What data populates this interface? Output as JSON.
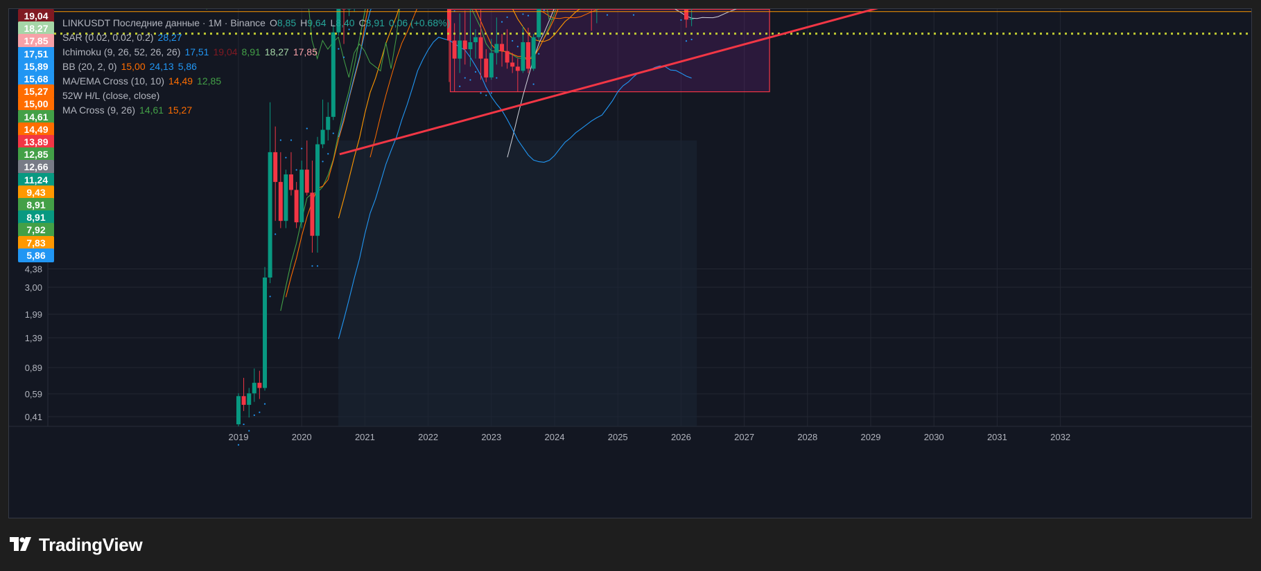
{
  "header": {
    "symbol_line": [
      {
        "text": "LINKUSDT Последние данные · 1M · Binance",
        "color": "#b2b5be"
      },
      {
        "text": "O",
        "color": "#b2b5be"
      },
      {
        "text": "8,85",
        "color": "#26a69a"
      },
      {
        "text": "H",
        "color": "#b2b5be"
      },
      {
        "text": "9,64",
        "color": "#26a69a"
      },
      {
        "text": "L",
        "color": "#b2b5be"
      },
      {
        "text": "8,40",
        "color": "#26a69a"
      },
      {
        "text": "C",
        "color": "#b2b5be"
      },
      {
        "text": "8,91",
        "color": "#26a69a"
      },
      {
        "text": "0,06 (+0.68%)",
        "color": "#26a69a"
      }
    ],
    "indicators": [
      {
        "name": "SAR (0.02, 0.02, 0.2)",
        "values": [
          {
            "text": "28,27",
            "color": "#2196f3"
          }
        ]
      },
      {
        "name": "Ichimoku (9, 26, 52, 26, 26)",
        "values": [
          {
            "text": "17,51",
            "color": "#2196f3"
          },
          {
            "text": "19,04",
            "color": "#801922"
          },
          {
            "text": "8,91",
            "color": "#43a047"
          },
          {
            "text": "18,27",
            "color": "#a5d6a7"
          },
          {
            "text": "17,85",
            "color": "#f7a1a8"
          }
        ]
      },
      {
        "name": "BB (20, 2, 0)",
        "values": [
          {
            "text": "15,00",
            "color": "#ff6d00"
          },
          {
            "text": "24,13",
            "color": "#2196f3"
          },
          {
            "text": "5,86",
            "color": "#2196f3"
          }
        ]
      },
      {
        "name": "MA/EMA Cross (10, 10)",
        "values": [
          {
            "text": "14,49",
            "color": "#ff6d00"
          },
          {
            "text": "12,85",
            "color": "#43a047"
          }
        ]
      },
      {
        "name": "52W H/L (close, close)",
        "values": []
      },
      {
        "name": "MA Cross (9, 26)",
        "values": [
          {
            "text": "14,61",
            "color": "#43a047"
          },
          {
            "text": "15,27",
            "color": "#ff6d00"
          }
        ]
      }
    ]
  },
  "price_badges": [
    {
      "text": "19,04",
      "bg": "#801922"
    },
    {
      "text": "18,27",
      "bg": "#a5d6a7"
    },
    {
      "text": "17,85",
      "bg": "#f7a1a8"
    },
    {
      "text": "17,51",
      "bg": "#2196f3"
    },
    {
      "text": "15,89",
      "bg": "#2196f3"
    },
    {
      "text": "15,68",
      "bg": "#2196f3"
    },
    {
      "text": "15,27",
      "bg": "#ff6d00"
    },
    {
      "text": "15,00",
      "bg": "#ff6d00"
    },
    {
      "text": "14,61",
      "bg": "#43a047"
    },
    {
      "text": "14,49",
      "bg": "#ff6d00"
    },
    {
      "text": "13,89",
      "bg": "#f23645"
    },
    {
      "text": "12,85",
      "bg": "#43a047"
    },
    {
      "text": "12,66",
      "bg": "#787b86"
    },
    {
      "text": "11,24",
      "bg": "#089981"
    },
    {
      "text": "9,43",
      "bg": "#ff9800"
    },
    {
      "text": "8,91",
      "bg": "#43a047"
    },
    {
      "text": "8,91",
      "bg": "#089981"
    },
    {
      "text": "7,92",
      "bg": "#43a047"
    },
    {
      "text": "7,83",
      "bg": "#ff9800"
    },
    {
      "text": "5,86",
      "bg": "#2196f3"
    }
  ],
  "brand": {
    "name": "TradingView"
  },
  "chart_data": {
    "type": "candlestick",
    "symbol": "LINKUSDT",
    "interval": "1M",
    "exchange": "Binance",
    "scale": "log",
    "y_tick_labels": [
      "4,38",
      "3,00",
      "1,99",
      "1,39",
      "0,89",
      "0,59",
      "0,41"
    ],
    "x_tick_labels": [
      "2019",
      "2020",
      "2021",
      "2022",
      "2023",
      "2024",
      "2025",
      "2026",
      "2027",
      "2028",
      "2029",
      "2030",
      "2031",
      "2032"
    ],
    "last_bar": {
      "open": 8.85,
      "high": 9.64,
      "low": 8.4,
      "close": 8.91,
      "change": 0.06,
      "change_pct": "+0.68%"
    },
    "candles": [
      [
        2019.0,
        0.36,
        0.46,
        0.34,
        0.45
      ],
      [
        2019.083,
        0.45,
        0.52,
        0.4,
        0.42
      ],
      [
        2019.167,
        0.42,
        0.48,
        0.38,
        0.46
      ],
      [
        2019.25,
        0.46,
        0.56,
        0.43,
        0.5
      ],
      [
        2019.333,
        0.5,
        0.55,
        0.44,
        0.48
      ],
      [
        2019.417,
        0.48,
        1.25,
        0.47,
        1.15
      ],
      [
        2019.5,
        1.15,
        4.6,
        1.1,
        3.1
      ],
      [
        2019.583,
        3.1,
        3.8,
        1.8,
        2.45
      ],
      [
        2019.667,
        2.45,
        3.1,
        1.7,
        1.8
      ],
      [
        2019.75,
        1.8,
        2.7,
        1.7,
        2.6
      ],
      [
        2019.833,
        2.6,
        3.1,
        2.2,
        2.3
      ],
      [
        2019.917,
        2.3,
        2.45,
        1.7,
        1.78
      ],
      [
        2020.0,
        1.78,
        2.9,
        1.7,
        2.7
      ],
      [
        2020.083,
        2.7,
        3.4,
        2.2,
        2.25
      ],
      [
        2020.167,
        2.25,
        2.9,
        1.4,
        1.6
      ],
      [
        2020.25,
        1.6,
        3.5,
        1.4,
        3.3
      ],
      [
        2020.333,
        3.3,
        4.7,
        3.2,
        3.7
      ],
      [
        2020.417,
        3.7,
        4.6,
        3.4,
        4.1
      ],
      [
        2020.5,
        4.1,
        8.5,
        4.0,
        8.0
      ],
      [
        2020.583,
        8.0,
        20.0,
        7.8,
        14.5
      ],
      [
        2020.667,
        14.5,
        16.5,
        7.3,
        9.6
      ],
      [
        2020.75,
        9.6,
        13.2,
        9.1,
        10.8
      ],
      [
        2020.833,
        10.8,
        14.9,
        9.4,
        13.2
      ],
      [
        2020.917,
        13.2,
        14.2,
        9.8,
        11.2
      ],
      [
        2021.0,
        11.2,
        25.0,
        10.8,
        22.8
      ],
      [
        2021.083,
        22.8,
        36.9,
        20.5,
        30.5
      ],
      [
        2021.167,
        30.5,
        32.0,
        22.0,
        28.3
      ],
      [
        2021.25,
        28.3,
        44.3,
        26.2,
        38.0
      ],
      [
        2021.333,
        38.0,
        52.9,
        22.0,
        30.0
      ],
      [
        2021.417,
        30.0,
        30.5,
        17.2,
        23.5
      ],
      [
        2021.5,
        23.5,
        24.3,
        13.8,
        18.6
      ],
      [
        2021.583,
        18.6,
        29.8,
        17.4,
        26.4
      ],
      [
        2021.667,
        26.4,
        36.8,
        20.0,
        28.9
      ],
      [
        2021.75,
        28.9,
        33.0,
        24.0,
        31.3
      ],
      [
        2021.833,
        31.3,
        38.0,
        22.5,
        25.0
      ],
      [
        2021.917,
        25.0,
        26.8,
        16.7,
        19.8
      ],
      [
        2022.0,
        19.8,
        21.0,
        15.5,
        17.2
      ],
      [
        2022.083,
        17.2,
        19.4,
        12.0,
        14.1
      ],
      [
        2022.167,
        14.1,
        18.5,
        12.5,
        17.0
      ],
      [
        2022.25,
        17.0,
        17.5,
        10.4,
        11.3
      ],
      [
        2022.333,
        11.3,
        11.8,
        5.4,
        7.5
      ],
      [
        2022.417,
        7.5,
        8.6,
        5.0,
        6.5
      ],
      [
        2022.5,
        6.5,
        9.3,
        5.8,
        7.5
      ],
      [
        2022.583,
        7.5,
        9.5,
        6.2,
        7.0
      ],
      [
        2022.667,
        7.0,
        9.7,
        6.1,
        7.4
      ],
      [
        2022.75,
        7.4,
        8.2,
        6.5,
        7.7
      ],
      [
        2022.833,
        7.7,
        9.7,
        5.5,
        6.5
      ],
      [
        2022.917,
        6.5,
        7.0,
        5.4,
        5.6
      ],
      [
        2023.0,
        5.6,
        7.6,
        5.5,
        6.8
      ],
      [
        2023.083,
        6.8,
        9.0,
        6.2,
        7.3
      ],
      [
        2023.167,
        7.3,
        7.9,
        6.1,
        6.9
      ],
      [
        2023.25,
        6.9,
        8.2,
        6.0,
        6.3
      ],
      [
        2023.333,
        6.3,
        6.8,
        5.8,
        6.1
      ],
      [
        2023.417,
        6.1,
        6.5,
        5.0,
        5.9
      ],
      [
        2023.5,
        5.9,
        8.4,
        5.8,
        7.4
      ],
      [
        2023.583,
        7.4,
        8.3,
        5.8,
        6.0
      ],
      [
        2023.667,
        6.0,
        7.9,
        5.9,
        7.7
      ],
      [
        2023.75,
        7.7,
        11.5,
        7.5,
        11.0
      ],
      [
        2023.833,
        11.0,
        16.0,
        10.6,
        15.5
      ],
      [
        2023.917,
        15.5,
        17.0,
        12.8,
        15.3
      ],
      [
        2024.0,
        15.3,
        16.8,
        13.1,
        16.3
      ],
      [
        2024.083,
        16.3,
        21.0,
        15.9,
        18.9
      ],
      [
        2024.167,
        18.9,
        22.9,
        17.5,
        21.0
      ],
      [
        2024.25,
        21.0,
        21.5,
        12.5,
        13.6
      ],
      [
        2024.333,
        13.6,
        18.3,
        12.9,
        16.9
      ],
      [
        2024.417,
        16.9,
        18.9,
        12.8,
        14.1
      ],
      [
        2024.5,
        14.1,
        14.9,
        12.0,
        12.2
      ],
      [
        2024.583,
        12.2,
        12.5,
        8.1,
        10.5
      ],
      [
        2024.667,
        10.5,
        12.4,
        8.6,
        11.4
      ],
      [
        2024.75,
        11.4,
        13.0,
        10.5,
        11.2
      ],
      [
        2024.833,
        11.2,
        21.8,
        10.2,
        21.0
      ],
      [
        2024.917,
        21.0,
        30.9,
        17.3,
        20.2
      ],
      [
        2025.0,
        20.2,
        26.4,
        17.0,
        25.0
      ],
      [
        2025.083,
        25.0,
        27.1,
        14.9,
        15.2
      ],
      [
        2025.167,
        15.2,
        16.5,
        12.5,
        13.4
      ],
      [
        2025.25,
        13.4,
        15.5,
        10.2,
        13.8
      ],
      [
        2025.333,
        13.8,
        17.9,
        13.5,
        15.0
      ],
      [
        2025.417,
        15.0,
        16.0,
        12.3,
        13.2
      ],
      [
        2025.5,
        13.2,
        19.0,
        12.5,
        18.2
      ],
      [
        2025.583,
        18.2,
        27.0,
        17.0,
        24.0
      ],
      [
        2025.667,
        24.0,
        24.9,
        19.5,
        21.0
      ],
      [
        2025.75,
        21.0,
        22.5,
        10.0,
        16.8
      ],
      [
        2025.833,
        16.8,
        17.5,
        11.2,
        12.3
      ],
      [
        2025.917,
        12.3,
        14.5,
        11.5,
        12.7
      ],
      [
        2026.0,
        12.7,
        12.8,
        9.8,
        11.0
      ],
      [
        2026.083,
        11.0,
        11.3,
        8.3,
        8.85
      ],
      [
        2026.167,
        8.85,
        9.64,
        8.4,
        8.91
      ]
    ],
    "drawings": {
      "triangle_upper_line": {
        "from": [
          2021.4,
          51.0
        ],
        "to": [
          2031.3,
          14.0
        ]
      },
      "triangle_lower_line": {
        "from": [
          2020.6,
          3.05
        ],
        "to": [
          2031.1,
          12.7
        ]
      },
      "support_zone": {
        "from_x": 2022.35,
        "to_x": 2027.4,
        "top": 9.6,
        "bottom": 5.0
      },
      "horizontal_lines": [
        {
          "value": 21.9,
          "style": "dotted",
          "color": "#ffeb3b"
        },
        {
          "value": 18.9,
          "style": "solid",
          "color": "#ff9800"
        },
        {
          "value": 9.43,
          "style": "solid",
          "color": "#ff9800"
        },
        {
          "value": 7.92,
          "style": "dotted",
          "color": "#c0ca33"
        }
      ]
    },
    "grid": true
  }
}
